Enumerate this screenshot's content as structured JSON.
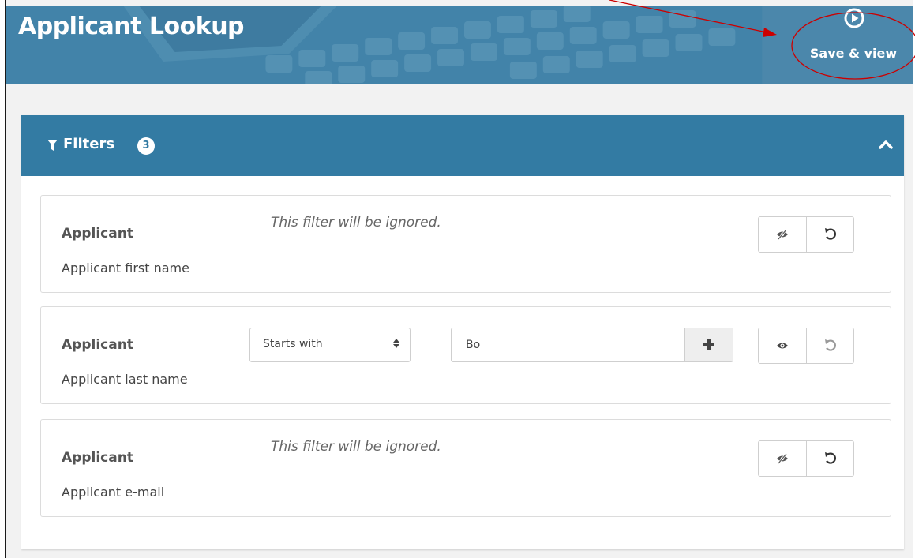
{
  "header": {
    "title": "Applicant Lookup",
    "save_view_label": "Save & view",
    "save_view_icon": "play-circle-icon"
  },
  "filters_panel": {
    "title": "Filters",
    "count": "3",
    "collapse_icon": "chevron-up-icon",
    "filter_icon": "funnel-icon",
    "rows": [
      {
        "entity": "Applicant",
        "field": "Applicant first name",
        "ignored_message": "This filter will be ignored.",
        "visibility_icon": "eye-slash-icon",
        "reset_icon": "undo-icon"
      },
      {
        "entity": "Applicant",
        "field": "Applicant last name",
        "operator": "Starts with",
        "value": "Bo",
        "add_icon": "plus-icon",
        "visibility_icon": "eye-icon",
        "reset_icon": "undo-icon"
      },
      {
        "entity": "Applicant",
        "field": "Applicant e-mail",
        "ignored_message": "This filter will be ignored.",
        "visibility_icon": "eye-slash-icon",
        "reset_icon": "undo-icon"
      }
    ]
  },
  "colors": {
    "header_blue": "#3d7da3",
    "panel_header_blue": "#337ba3",
    "annotation_red": "#cc0000"
  }
}
